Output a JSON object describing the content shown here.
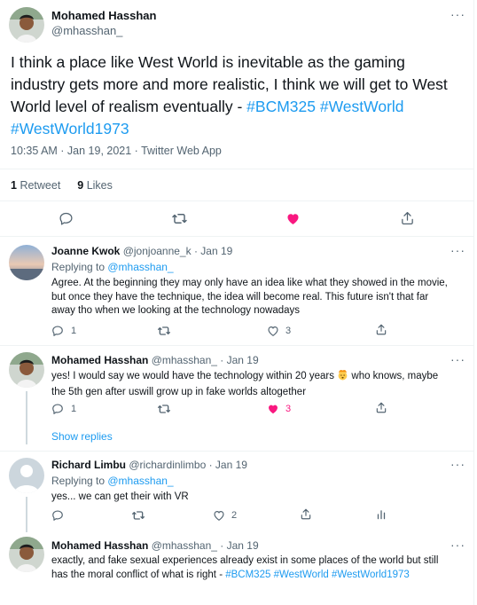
{
  "main": {
    "author_name": "Mohamed Hasshan",
    "author_handle": "@mhasshan_",
    "text_1": "I think a place like West World is inevitable as the gaming",
    "text_2": "industry gets more and more realistic, I think we will get to West",
    "text_3": "World level of realism eventually - ",
    "hashtag_1": "#BCM325",
    "hashtag_2": "#WestWorld",
    "hashtag_3": "#WestWorld1973",
    "timestamp": "10:35 AM · Jan 19, 2021 · Twitter Web App",
    "retweet_count": "1",
    "retweet_label": "Retweet",
    "like_count": "9",
    "like_label": "Likes",
    "more": "···"
  },
  "replies": [
    {
      "name": "Joanne Kwok",
      "handle": "@jonjoanne_k",
      "date": "· Jan 19",
      "replying_prefix": "Replying to ",
      "replying_to": "@mhasshan_",
      "lines": [
        "Agree. At the beginning they may only have an idea like what they showed in the movie,",
        "but once they have the technique, the idea will become real. This future isn't that far",
        "away tho when we looking at the technology nowadays"
      ],
      "reply_count": "1",
      "like_count": "3",
      "more": "···"
    },
    {
      "name": "Mohamed Hasshan",
      "handle": "@mhasshan_",
      "date": "· Jan 19",
      "line_1a": "yes! I would say we would have the technology within 20 years ",
      "line_1b": " who knows, maybe",
      "line_2": "the 5th gen after uswill grow up in fake worlds altogether",
      "reply_count": "1",
      "like_count": "3",
      "more": "···"
    },
    {
      "name": "Richard Limbu",
      "handle": "@richardinlimbo",
      "date": "· Jan 19",
      "replying_prefix": "Replying to ",
      "replying_to": "@mhasshan_",
      "text": "yes... we can get their with VR",
      "like_count": "2",
      "more": "···"
    },
    {
      "name": "Mohamed Hasshan",
      "handle": "@mhasshan_",
      "date": "· Jan 19",
      "line_1": "exactly, and fake sexual experiences already exist in some places of the world but still",
      "line_2": "has the moral conflict of what is right - ",
      "hashtag_1": "#BCM325",
      "hashtag_2": "#WestWorld",
      "hashtag_3": "#WestWorld1973",
      "more": "···"
    }
  ],
  "show_replies": "Show replies",
  "colors": {
    "accent": "#1d9bf0",
    "like": "#f91880",
    "secondary_text": "#536471",
    "divider": "#eff3f4"
  },
  "icons": [
    "reply-icon",
    "retweet-icon",
    "like-icon",
    "share-icon",
    "analytics-icon",
    "more-icon",
    "emoji-exploding-head"
  ]
}
